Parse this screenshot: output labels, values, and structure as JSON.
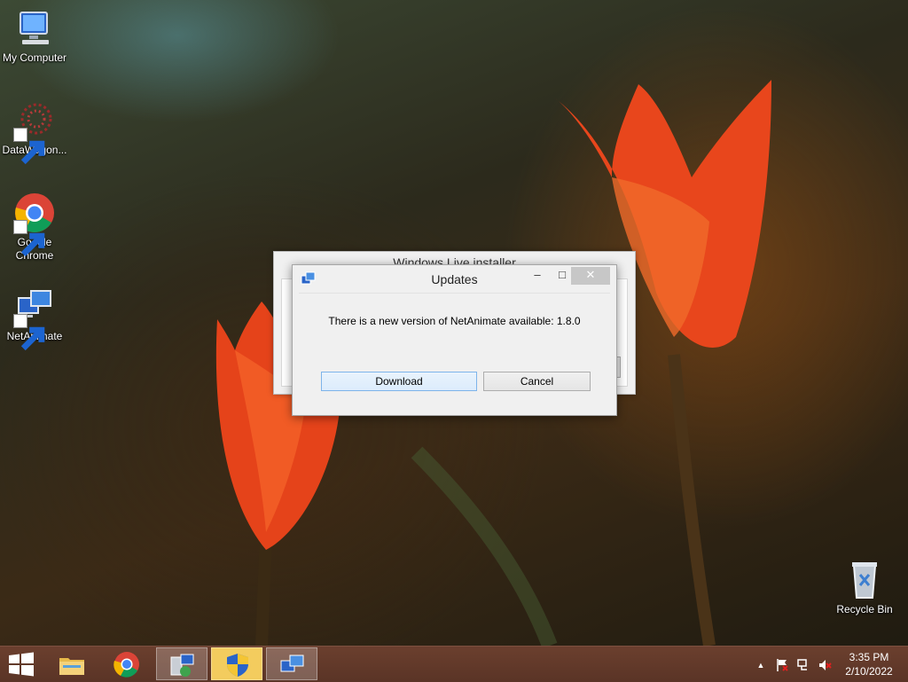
{
  "desktop": {
    "icons": [
      {
        "label": "My Computer",
        "icon": "computer-icon"
      },
      {
        "label": "DataWagon...",
        "icon": "datawagon-icon"
      },
      {
        "label": "Google Chrome",
        "icon": "chrome-icon"
      },
      {
        "label": "NetAnimate",
        "icon": "netanimate-icon"
      },
      {
        "label": "Recycle Bin",
        "icon": "recycle-bin-icon"
      }
    ]
  },
  "background_window": {
    "title": "Windows Live installer"
  },
  "dialog": {
    "title": "Updates",
    "minimize_glyph": "–",
    "maximize_glyph": "□",
    "close_glyph": "✕",
    "message": "There is a new version of NetAnimate available: 1.8.0",
    "download_label": "Download",
    "cancel_label": "Cancel"
  },
  "taskbar": {
    "items": [
      "file-explorer-icon",
      "chrome-icon",
      "installer-icon",
      "uac-shield-icon",
      "netanimate-icon"
    ],
    "tray": {
      "icons": [
        "show-hidden-icons-icon",
        "action-center-flag-icon",
        "network-icon",
        "volume-muted-icon"
      ],
      "chevron": "▲"
    },
    "clock": {
      "time": "3:35 PM",
      "date": "2/10/2022"
    }
  },
  "colors": {
    "taskbar": "#5a3426",
    "dialog_bg": "#f0f0f0",
    "accent_button": "#dcecfc",
    "close_button": "#c7c7c7",
    "highlight_item": "#f3cc5e"
  }
}
